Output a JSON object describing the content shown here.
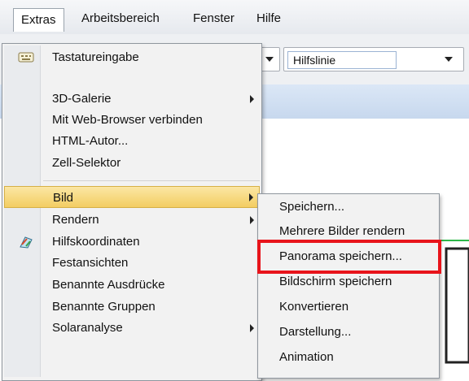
{
  "menubar": {
    "items": [
      {
        "label": "Extras"
      },
      {
        "label": "Arbeitsbereich"
      },
      {
        "label": "Fenster"
      },
      {
        "label": "Hilfe"
      }
    ]
  },
  "toolbar": {
    "combo_value": "Hilfslinie"
  },
  "extras_menu": {
    "items": [
      {
        "label": "Tastatureingabe",
        "icon": "keyboard-icon"
      },
      {
        "label": "3D-Galerie",
        "submenu": true
      },
      {
        "label": "Mit Web-Browser verbinden"
      },
      {
        "label": "HTML-Autor..."
      },
      {
        "label": "Zell-Selektor"
      },
      {
        "label": "Bild",
        "submenu": true,
        "highlighted": true
      },
      {
        "label": "Rendern",
        "submenu": true
      },
      {
        "label": "Hilfskoordinaten",
        "icon": "coordinates-icon"
      },
      {
        "label": "Festansichten"
      },
      {
        "label": "Benannte Ausdrücke"
      },
      {
        "label": "Benannte Gruppen"
      },
      {
        "label": "Solaranalyse",
        "submenu": true
      }
    ]
  },
  "bild_submenu": {
    "items": [
      {
        "label": "Speichern..."
      },
      {
        "label": "Mehrere Bilder rendern"
      },
      {
        "label": "Panorama speichern...",
        "highlighted_box": true
      },
      {
        "label": "Bildschirm speichern"
      },
      {
        "label": "Konvertieren"
      },
      {
        "label": "Darstellung..."
      },
      {
        "label": "Animation"
      }
    ]
  },
  "colors": {
    "highlight": "#f3cd62",
    "annotation_red": "#e8141b"
  }
}
